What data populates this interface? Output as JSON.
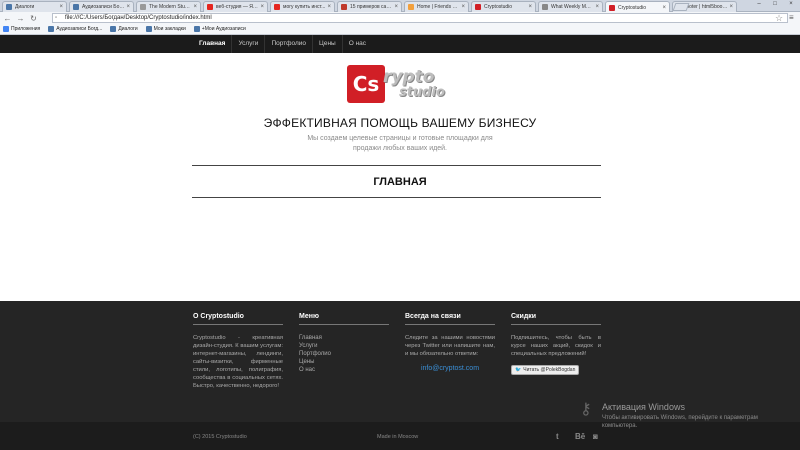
{
  "browser": {
    "tabs": [
      {
        "label": "Диалоги",
        "fav": "#4a76a8"
      },
      {
        "label": "Аудиозаписи Богда...",
        "fav": "#4a76a8"
      },
      {
        "label": "The Modern Studi...",
        "fav": "#999999"
      },
      {
        "label": "веб-студия — Янд...",
        "fav": "#e52620"
      },
      {
        "label": "могу купить инст...",
        "fav": "#e52620"
      },
      {
        "label": "15 примеров сайто...",
        "fav": "#c0392b"
      },
      {
        "label": "Home | Friends of ...",
        "fav": "#f2a03d"
      },
      {
        "label": "Cryptostudio",
        "fav": "#d11f26"
      },
      {
        "label": "What Weekly Mag...",
        "fav": "#888888"
      },
      {
        "label": "Cryptostudio",
        "fav": "#d11f26",
        "active": true
      },
      {
        "label": "footer | html5book...",
        "fav": "#3c9a3c"
      }
    ],
    "address": "file:///C:/Users/Богдан/Desktop/Cryptostudio/index.html",
    "window_buttons": [
      "–",
      "□",
      "×"
    ],
    "bookmarks": [
      {
        "label": "Приложения",
        "icon": "#4285f4"
      },
      {
        "label": "Аудиозаписи Богд...",
        "icon": "#4a76a8"
      },
      {
        "label": "Диалоги",
        "icon": "#4a76a8"
      },
      {
        "label": "Мои закладки",
        "icon": "#4a76a8"
      },
      {
        "label": "+Мои Аудиозаписи",
        "icon": "#4a76a8"
      }
    ]
  },
  "nav": {
    "items": [
      "Главная",
      "Услуги",
      "Портфолио",
      "Цены",
      "О нас"
    ],
    "active_index": 0
  },
  "logo": {
    "mark": "Cs",
    "word1": "rypto",
    "word2": "studio",
    "mark_color": "#d11f26"
  },
  "hero": {
    "title": "ЭФФЕКТИВНАЯ ПОМОЩЬ ВАШЕМУ БИЗНЕСУ",
    "subtitle": "Мы создаем целевые страницы и готовые площадки для продажи любых ваших идей."
  },
  "section": {
    "title": "ГЛАВНАЯ"
  },
  "footer": {
    "about": {
      "title": "О Cryptostudio",
      "text": "Cryptostudio - креативная дизайн-студия. К вашим услугам: интернет-магазины, лендинги, сайты-визитки, фирменные стили, логотипы, полиграфия, сообщества в социальных сетях. Быстро, качественно, недорого!"
    },
    "menu": {
      "title": "Меню",
      "items": [
        "Главная",
        "Услуги",
        "Портфолио",
        "Цены",
        "О нас"
      ]
    },
    "contact": {
      "title": "Всегда на связи",
      "text": "Следите за нашими новостями через Twitter или напишите нам, и мы обязательно ответим:",
      "email": "info@cryptost.com"
    },
    "discounts": {
      "title": "Скидки",
      "text": "Подпишитесь, чтобы быть в курсе наших акций, скидок и специальных предложений!",
      "twitter_button": "Читать @PolekBogdan"
    },
    "copyright": "(C) 2015 Cryptostudio",
    "made_in": "Made in Moscow",
    "social_icons": [
      "twitter-icon",
      "behance-icon",
      "instagram-icon"
    ]
  },
  "windows_activation": {
    "title": "Активация Windows",
    "text": "Чтобы активировать Windows, перейдите к параметрам компьютера."
  }
}
